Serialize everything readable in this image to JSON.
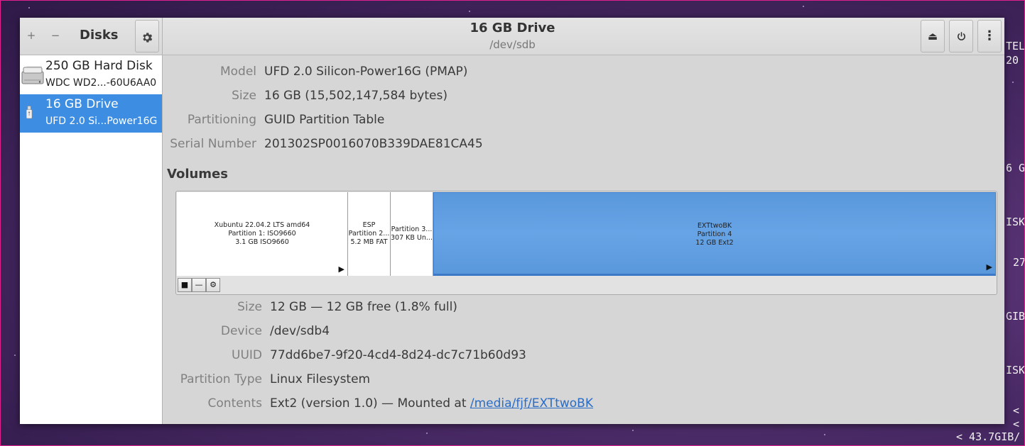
{
  "terminal": {
    "lines": [
      "TEL",
      "20",
      "6 G",
      "ISK",
      "27",
      "GIB",
      "ISK",
      "<",
      "<",
      "< 43.7GIB/"
    ]
  },
  "headerbar": {
    "add_icon": "+",
    "remove_icon": "−",
    "app_title": "Disks",
    "settings_icon": "gear-icon",
    "drive_title": "16 GB Drive",
    "drive_device": "/dev/sdb",
    "eject_icon": "⏏",
    "power_icon": "⏻",
    "menu_icon": "⋮"
  },
  "sidebar": {
    "items": [
      {
        "name": "250 GB Hard Disk",
        "model": "WDC WD2...-60U6AA0",
        "icon": "hard-disk-icon",
        "selected": false
      },
      {
        "name": "16 GB Drive",
        "model": "UFD 2.0 Si...Power16G",
        "icon": "usb-drive-icon",
        "selected": true
      }
    ]
  },
  "drive_properties": {
    "model_label": "Model",
    "model_value": "UFD 2.0 Silicon-Power16G (PMAP)",
    "size_label": "Size",
    "size_value": "16 GB (15,502,147,584 bytes)",
    "partitioning_label": "Partitioning",
    "partitioning_value": "GUID Partition Table",
    "serial_label": "Serial Number",
    "serial_value": "201302SP0016070B339DAE81CA45"
  },
  "volumes": {
    "title": "Volumes",
    "partitions": [
      {
        "line1": "Xubuntu 22.04.2 LTS amd64",
        "line2": "Partition 1: ISO9660",
        "line3": "3.1 GB ISO9660",
        "has_arrow": true,
        "selected": false
      },
      {
        "line1": "ESP",
        "line2": "Partition 2...",
        "line3": "5.2 MB FAT",
        "has_arrow": false,
        "selected": false
      },
      {
        "line1": "Partition 3...",
        "line2": "307 KB Un...",
        "line3": "",
        "has_arrow": false,
        "selected": false
      },
      {
        "line1": "EXTtwoBK",
        "line2": "Partition 4",
        "line3": "12 GB Ext2",
        "has_arrow": true,
        "selected": true
      }
    ],
    "arrow": "▶",
    "toolbar": {
      "stop": "■",
      "remove": "—",
      "options": "⚙"
    }
  },
  "volume_properties": {
    "size_label": "Size",
    "size_value": "12 GB — 12 GB free (1.8% full)",
    "device_label": "Device",
    "device_value": "/dev/sdb4",
    "uuid_label": "UUID",
    "uuid_value": "77dd6be7-9f20-4cd4-8d24-dc7c71b60d93",
    "parttype_label": "Partition Type",
    "parttype_value": "Linux Filesystem",
    "contents_label": "Contents",
    "contents_value": "Ext2 (version 1.0) — Mounted at ",
    "mount_link": "/media/fjf/EXTtwoBK"
  }
}
